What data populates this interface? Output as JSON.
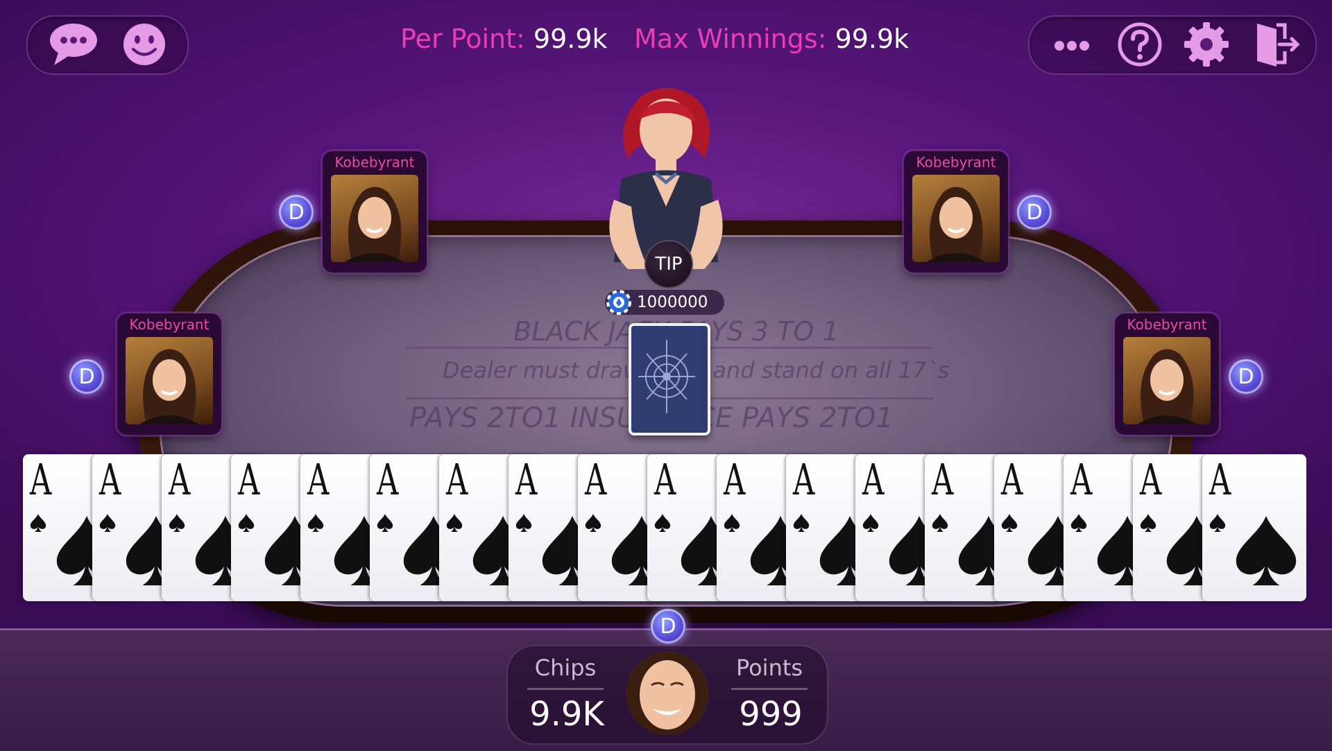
{
  "header": {
    "per_point_label": "Per Point:",
    "per_point_value": "99.9k",
    "max_winnings_label": "Max Winnings:",
    "max_winnings_value": "99.9k"
  },
  "top_left_icons": [
    "chat-bubble-icon",
    "emoji-icon"
  ],
  "top_right_icons": [
    "more-icon",
    "help-icon",
    "settings-icon",
    "exit-icon"
  ],
  "dealer": {
    "tip_label": "TIP",
    "pot_amount": "1000000"
  },
  "table_text": {
    "line1": "BLACK JACK PAYS 3 TO 1",
    "line2": "Dealer must draw to 16 and stand on all 17`s",
    "line3": "PAYS 2TO1   INSURANCE   PAYS 2TO1"
  },
  "players": [
    {
      "name": "Kobebyrant",
      "badge": "D"
    },
    {
      "name": "Kobebyrant",
      "badge": "D"
    },
    {
      "name": "Kobebyrant",
      "badge": "D"
    },
    {
      "name": "Kobebyrant",
      "badge": "D"
    }
  ],
  "hand": {
    "cards": [
      {
        "rank": "A",
        "suit": "spade"
      },
      {
        "rank": "A",
        "suit": "spade"
      },
      {
        "rank": "A",
        "suit": "spade"
      },
      {
        "rank": "A",
        "suit": "spade"
      },
      {
        "rank": "A",
        "suit": "spade"
      },
      {
        "rank": "A",
        "suit": "spade"
      },
      {
        "rank": "A",
        "suit": "spade"
      },
      {
        "rank": "A",
        "suit": "spade"
      },
      {
        "rank": "A",
        "suit": "spade"
      },
      {
        "rank": "A",
        "suit": "spade"
      },
      {
        "rank": "A",
        "suit": "spade"
      },
      {
        "rank": "A",
        "suit": "spade"
      },
      {
        "rank": "A",
        "suit": "spade"
      },
      {
        "rank": "A",
        "suit": "spade"
      },
      {
        "rank": "A",
        "suit": "spade"
      },
      {
        "rank": "A",
        "suit": "spade"
      },
      {
        "rank": "A",
        "suit": "spade"
      },
      {
        "rank": "A",
        "suit": "spade"
      }
    ]
  },
  "me": {
    "badge": "D",
    "chips_label": "Chips",
    "chips_value": "9.9K",
    "points_label": "Points",
    "points_value": "999"
  },
  "colors": {
    "accent_pink": "#ea3fb4",
    "badge_blue": "#5a4ad8",
    "background_purple": "#56157a"
  }
}
